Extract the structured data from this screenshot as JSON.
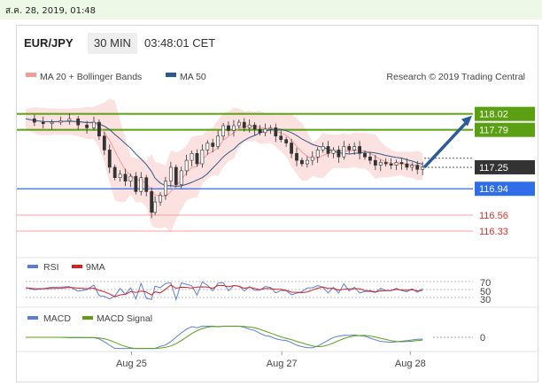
{
  "page": {
    "date_stamp": "ส.ค. 28, 2019, 01:48"
  },
  "header": {
    "symbol": "EUR/JPY",
    "timeframe": "30 MIN",
    "time": "03:48:01 CET"
  },
  "legend": {
    "ma20": {
      "label": "MA 20 + Bollinger Bands",
      "color": "#f29b9b"
    },
    "ma50": {
      "label": "MA 50",
      "color": "#2d5a8a"
    },
    "credit": "Research © 2019 Trading Central"
  },
  "chart_data": [
    {
      "type": "line",
      "panel": "price",
      "ylim": [
        116.1,
        118.45
      ],
      "x_ticks": [
        {
          "label": "Aug 25",
          "x": 121
        },
        {
          "label": "Aug 27",
          "x": 293
        },
        {
          "label": "Aug 28",
          "x": 440
        }
      ],
      "x_count": 466,
      "close": [
        [
          0,
          117.95
        ],
        [
          10,
          117.9
        ],
        [
          20,
          117.88
        ],
        [
          30,
          117.9
        ],
        [
          40,
          117.92
        ],
        [
          50,
          117.95
        ],
        [
          60,
          117.86
        ],
        [
          70,
          117.82
        ],
        [
          78,
          117.9
        ],
        [
          84,
          117.7
        ],
        [
          90,
          117.5
        ],
        [
          96,
          117.25
        ],
        [
          102,
          117.1
        ],
        [
          108,
          117.15
        ],
        [
          114,
          117.05
        ],
        [
          120,
          117.12
        ],
        [
          126,
          116.9
        ],
        [
          132,
          117.1
        ],
        [
          138,
          116.9
        ],
        [
          144,
          116.6
        ],
        [
          148,
          116.75
        ],
        [
          154,
          116.85
        ],
        [
          160,
          117.05
        ],
        [
          166,
          117.25
        ],
        [
          172,
          117.0
        ],
        [
          178,
          117.2
        ],
        [
          184,
          117.35
        ],
        [
          190,
          117.45
        ],
        [
          196,
          117.3
        ],
        [
          202,
          117.5
        ],
        [
          208,
          117.6
        ],
        [
          214,
          117.55
        ],
        [
          220,
          117.7
        ],
        [
          226,
          117.85
        ],
        [
          232,
          117.78
        ],
        [
          238,
          117.85
        ],
        [
          244,
          117.9
        ],
        [
          250,
          117.82
        ],
        [
          256,
          117.86
        ],
        [
          262,
          117.8
        ],
        [
          268,
          117.75
        ],
        [
          274,
          117.8
        ],
        [
          280,
          117.82
        ],
        [
          286,
          117.7
        ],
        [
          292,
          117.65
        ],
        [
          298,
          117.6
        ],
        [
          304,
          117.45
        ],
        [
          310,
          117.35
        ],
        [
          316,
          117.3
        ],
        [
          322,
          117.35
        ],
        [
          328,
          117.4
        ],
        [
          334,
          117.5
        ],
        [
          340,
          117.55
        ],
        [
          346,
          117.45
        ],
        [
          352,
          117.5
        ],
        [
          358,
          117.4
        ],
        [
          364,
          117.55
        ],
        [
          370,
          117.5
        ],
        [
          376,
          117.55
        ],
        [
          382,
          117.45
        ],
        [
          388,
          117.4
        ],
        [
          394,
          117.35
        ],
        [
          400,
          117.28
        ],
        [
          406,
          117.32
        ],
        [
          412,
          117.3
        ],
        [
          418,
          117.28
        ],
        [
          424,
          117.32
        ],
        [
          430,
          117.3
        ],
        [
          436,
          117.25
        ],
        [
          442,
          117.28
        ],
        [
          448,
          117.22
        ],
        [
          454,
          117.25
        ]
      ],
      "series": [
        {
          "name": "MA 20 + Bollinger Bands",
          "color": "#f29b9b"
        },
        {
          "name": "MA 50",
          "color": "#2d5a8a"
        }
      ],
      "levels": [
        {
          "value": 118.02,
          "label": "118.02",
          "style": "resistance",
          "color": "#5aa012"
        },
        {
          "value": 117.79,
          "label": "117.79",
          "style": "resistance",
          "color": "#5aa012"
        },
        {
          "value": 117.25,
          "label": "117.25",
          "style": "last",
          "color": "#333333"
        },
        {
          "value": 116.94,
          "label": "116.94",
          "style": "pivot",
          "color": "#2f6ee8"
        },
        {
          "value": 116.56,
          "label": "116.56",
          "style": "support",
          "color": "#d9312b"
        },
        {
          "value": 116.33,
          "label": "116.33",
          "style": "support",
          "color": "#d9312b"
        }
      ]
    },
    {
      "type": "line",
      "panel": "rsi",
      "ylim": [
        10,
        90
      ],
      "levels": [
        {
          "value": 70,
          "label": "70"
        },
        {
          "value": 50,
          "label": "50"
        },
        {
          "value": 30,
          "label": "30"
        }
      ],
      "series": [
        {
          "name": "RSI",
          "color": "#5b7fd6"
        },
        {
          "name": "9MA",
          "color": "#d62020"
        }
      ]
    },
    {
      "type": "line",
      "panel": "macd",
      "ylim": [
        -1,
        1
      ],
      "levels": [
        {
          "value": 0,
          "label": "0"
        }
      ],
      "series": [
        {
          "name": "MACD",
          "color": "#5b7fd6"
        },
        {
          "name": "MACD Signal",
          "color": "#5aa012"
        }
      ]
    }
  ]
}
